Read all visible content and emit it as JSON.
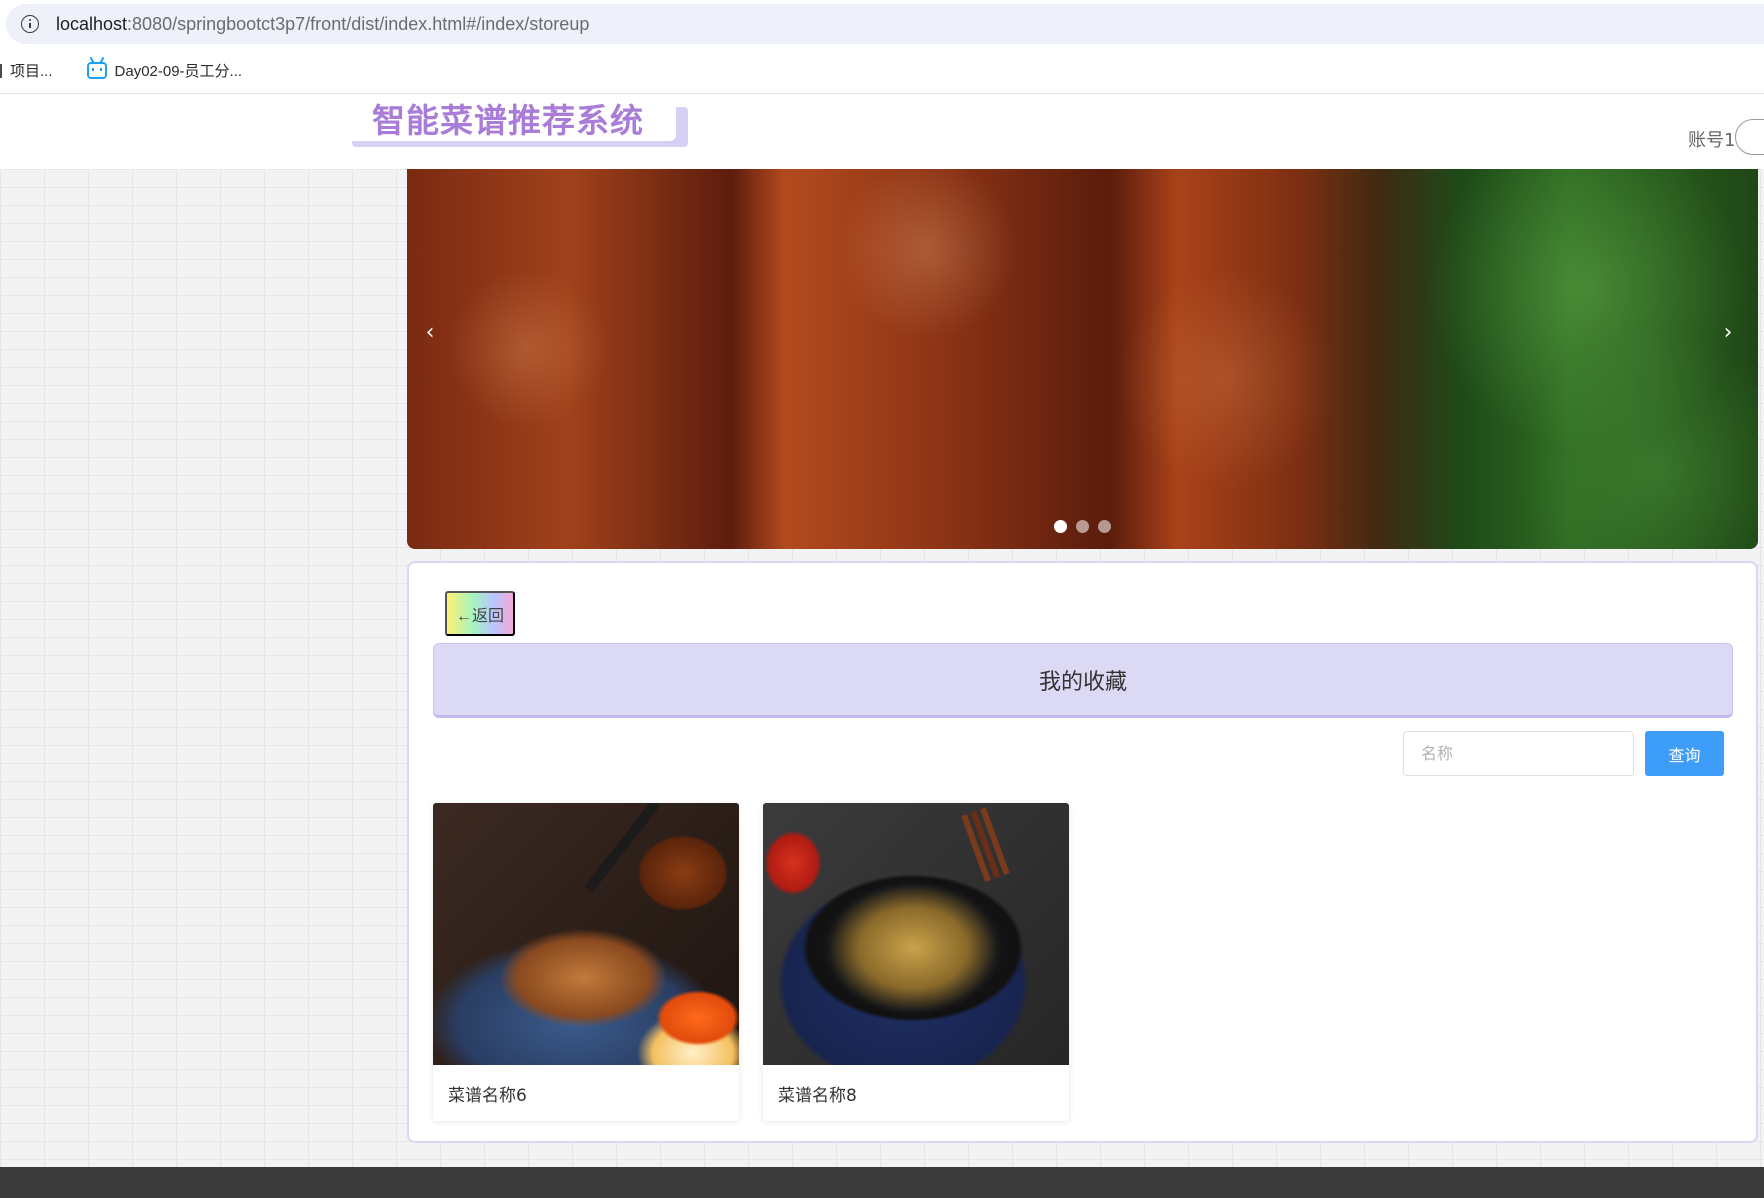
{
  "browser": {
    "url_host": "localhost",
    "url_rest": ":8080/springbootct3p7/front/dist/index.html#/index/storeup",
    "bookmarks": [
      {
        "label": "项目..."
      },
      {
        "label": "Day02-09-员工分..."
      }
    ]
  },
  "header": {
    "logo": "智能菜谱推荐系统",
    "account": "账号1"
  },
  "carousel": {
    "prev_icon": "chevron-left-icon",
    "next_icon": "chevron-right-icon",
    "prev_glyph": "‹",
    "next_glyph": "›",
    "active_index": 0
  },
  "main": {
    "back_label": "←返回",
    "title": "我的收藏",
    "search": {
      "placeholder": "名称",
      "value": ""
    },
    "search_button": "查询",
    "items": [
      {
        "name": "菜谱名称6"
      },
      {
        "name": "菜谱名称8"
      }
    ]
  },
  "colors": {
    "logo": "#a97cd8",
    "title_bar": "#dcd9f5",
    "search_button": "#3e9df8",
    "footer": "#3a3a3a"
  }
}
